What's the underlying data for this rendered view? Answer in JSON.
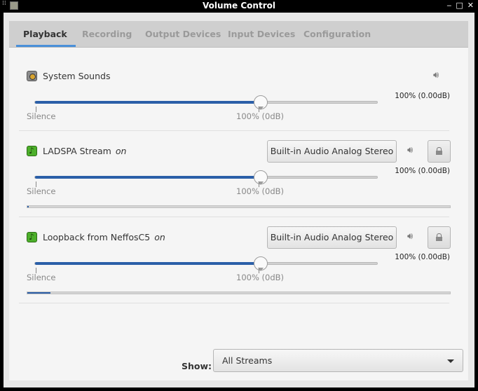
{
  "window": {
    "title": "Volume Control",
    "controls": {
      "minimize": "‒",
      "maximize": "□",
      "close": "✕"
    }
  },
  "tabs": [
    {
      "label": "Playback",
      "active": true
    },
    {
      "label": "Recording",
      "active": false
    },
    {
      "label": "Output Devices",
      "active": false
    },
    {
      "label": "Input Devices",
      "active": false
    },
    {
      "label": "Configuration",
      "active": false
    }
  ],
  "streams": [
    {
      "name": "System Sounds",
      "state": "",
      "icon": "system-sounds-icon",
      "percent_label": "100% (0.00dB)",
      "volume_fraction": 0.66,
      "scale_min_label": "Silence",
      "scale_mid_label": "100% (0dB)"
    },
    {
      "name": "LADSPA Stream",
      "state": "on",
      "icon": "music-note-icon",
      "device": "Built-in Audio Analog Stereo",
      "percent_label": "100% (0.00dB)",
      "volume_fraction": 0.66,
      "peak_level": 0.003,
      "scale_min_label": "Silence",
      "scale_mid_label": "100% (0dB)"
    },
    {
      "name": "Loopback from NeffosC5",
      "state": "on",
      "icon": "music-note-icon",
      "device": "Built-in Audio Analog Stereo",
      "percent_label": "100% (0.00dB)",
      "volume_fraction": 0.66,
      "peak_level": 0.055,
      "scale_min_label": "Silence",
      "scale_mid_label": "100% (0dB)"
    }
  ],
  "footer": {
    "show_label": "Show:",
    "show_value": "All Streams"
  },
  "colors": {
    "accent": "#4a90d9",
    "slider_fill": "#2b5fa8"
  }
}
